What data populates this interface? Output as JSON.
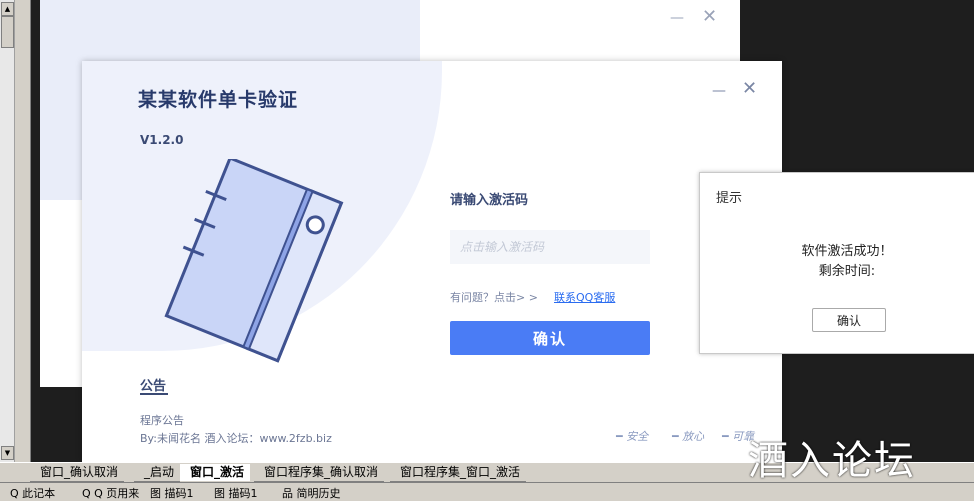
{
  "main_dialog": {
    "title": "某某软件单卡验证",
    "version": "V1.2.0",
    "minimize": "—",
    "close": "✕",
    "activation_label": "请输入激活码",
    "activation_placeholder": "点击输入激活码",
    "help_text": "有问题？点击> >",
    "help_link": "联系QQ客服",
    "confirm_label": "确认",
    "notice": {
      "title": "公告",
      "text": "程序公告",
      "by": "By:未闻花名 酒入论坛：www.2fzb.biz"
    },
    "footer_tags": [
      "安全",
      "放心",
      "可靠"
    ]
  },
  "back_window": {
    "minimize": "—",
    "close": "✕"
  },
  "message_box": {
    "title": "提示",
    "line1": "软件激活成功！",
    "line2": "剩余时间:",
    "ok_label": "确认"
  },
  "ide_tabs": [
    "窗口_确认取消",
    "_启动",
    "窗口_激活",
    "窗口程序集_确认取消",
    "窗口程序集_窗口_激活"
  ],
  "ide_active_tab": "窗口_激活",
  "status_items": [
    "Q 此记本",
    "Q Q 页用来",
    "图 描码1",
    "图 描码1",
    "品 简明历史"
  ],
  "watermark": "酒入论坛",
  "colors": {
    "accent": "#4a7cf5",
    "title": "#283a6b",
    "link": "#2a6cf0"
  }
}
